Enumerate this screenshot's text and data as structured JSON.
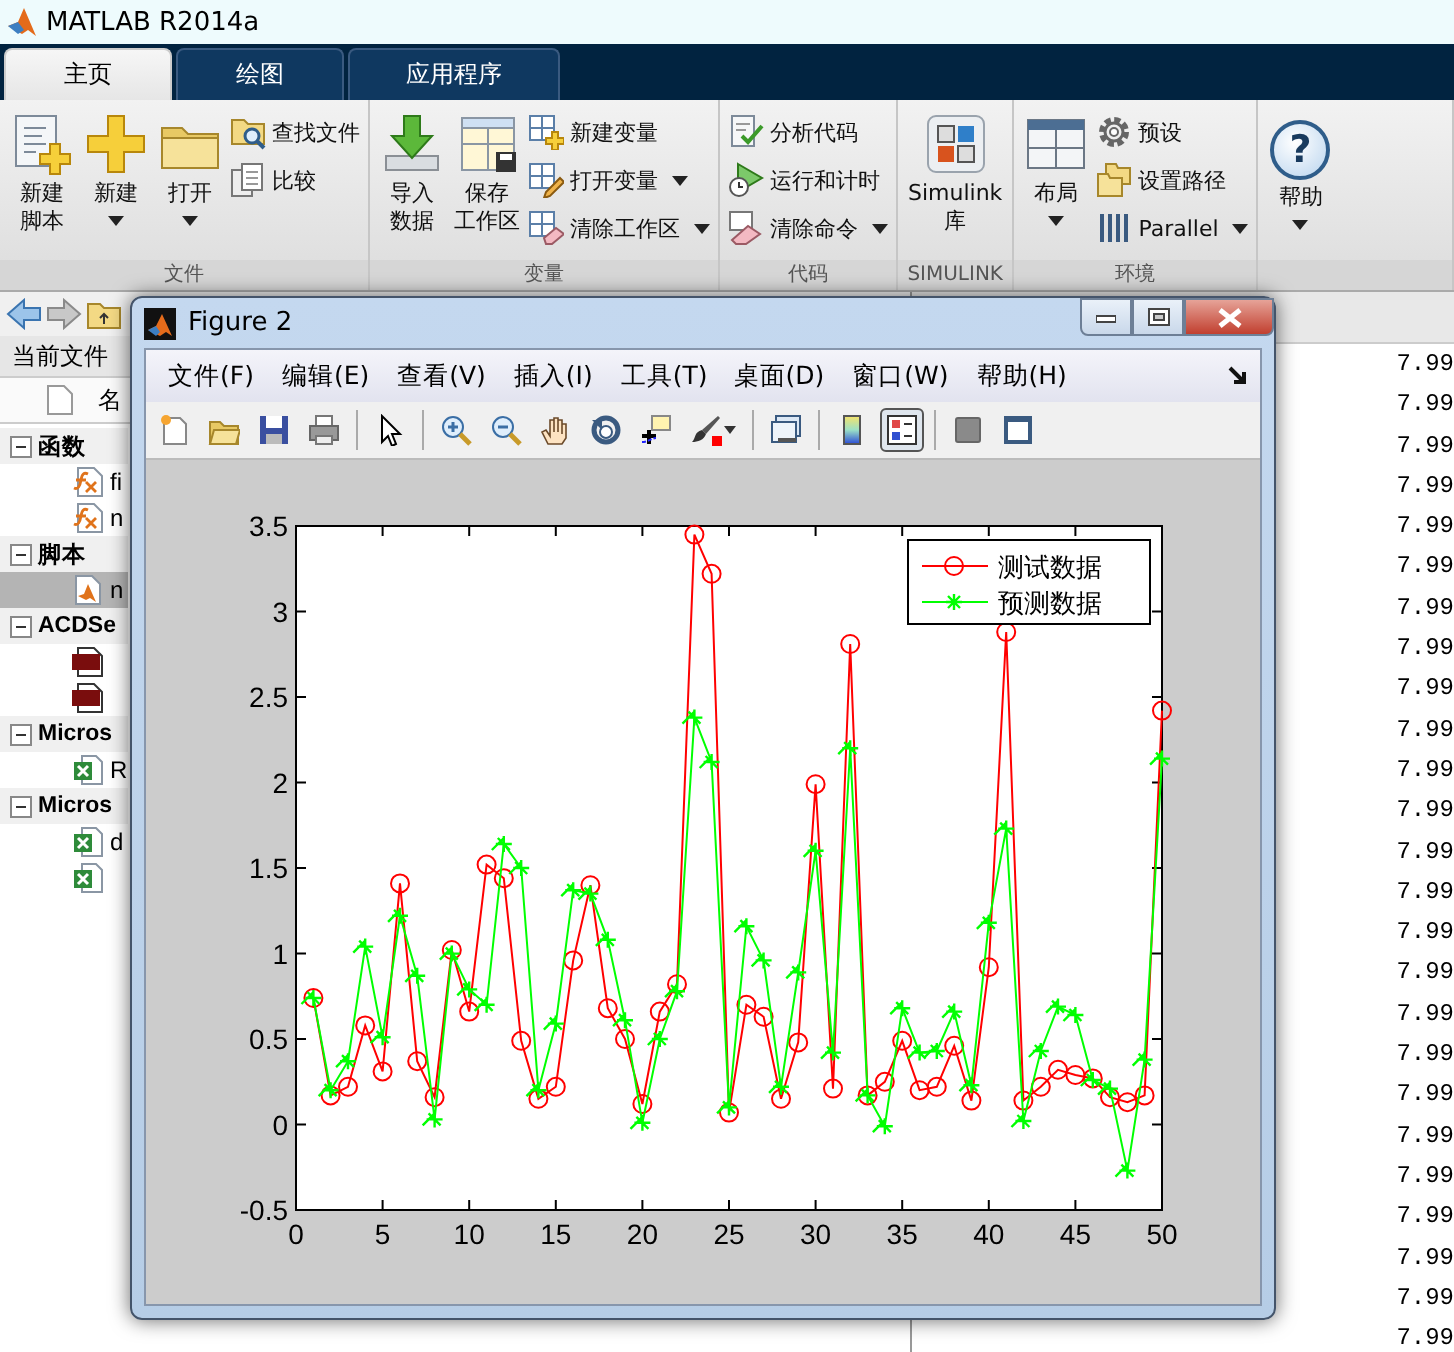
{
  "app": {
    "title": "MATLAB R2014a"
  },
  "tabs": [
    {
      "label": "主页",
      "selected": true
    },
    {
      "label": "绘图",
      "selected": false
    },
    {
      "label": "应用程序",
      "selected": false
    }
  ],
  "ribbon": {
    "sections": [
      {
        "title": "文件",
        "items": [
          {
            "kind": "large",
            "lines": [
              "新建",
              "脚本"
            ],
            "dropdown": false
          },
          {
            "kind": "large",
            "lines": [
              "新建"
            ],
            "dropdown": true
          },
          {
            "kind": "large",
            "lines": [
              "打开"
            ],
            "dropdown": true
          },
          {
            "kind": "small",
            "label": "查找文件",
            "dropdown": false
          },
          {
            "kind": "small",
            "label": "比较",
            "dropdown": false
          }
        ]
      },
      {
        "title": "变量",
        "items": [
          {
            "kind": "large",
            "lines": [
              "导入",
              "数据"
            ],
            "dropdown": false
          },
          {
            "kind": "large",
            "lines": [
              "保存",
              "工作区"
            ],
            "dropdown": false
          },
          {
            "kind": "small",
            "label": "新建变量",
            "dropdown": false
          },
          {
            "kind": "small",
            "label": "打开变量",
            "dropdown": true
          },
          {
            "kind": "small",
            "label": "清除工作区",
            "dropdown": true
          }
        ]
      },
      {
        "title": "代码",
        "items": [
          {
            "kind": "small",
            "label": "分析代码",
            "dropdown": false
          },
          {
            "kind": "small",
            "label": "运行和计时",
            "dropdown": false
          },
          {
            "kind": "small",
            "label": "清除命令",
            "dropdown": true
          }
        ]
      },
      {
        "title": "SIMULINK",
        "items": [
          {
            "kind": "large",
            "lines": [
              "Simulink",
              "库"
            ],
            "dropdown": false
          }
        ]
      },
      {
        "title": "环境",
        "items": [
          {
            "kind": "large",
            "lines": [
              "布局"
            ],
            "dropdown": true
          },
          {
            "kind": "small",
            "label": "预设",
            "dropdown": false
          },
          {
            "kind": "small",
            "label": "设置路径",
            "dropdown": false
          },
          {
            "kind": "small",
            "label": "Parallel",
            "dropdown": true
          }
        ]
      },
      {
        "items": [
          {
            "kind": "help",
            "glyph": "?",
            "lines": [
              "帮助"
            ],
            "dropdown": true
          }
        ]
      }
    ]
  },
  "files": {
    "header": "当前文件",
    "column": "名",
    "groups": [
      {
        "label": "函数",
        "expanded": true,
        "children": [
          {
            "kind": "function",
            "label": "fi",
            "selected": false
          },
          {
            "kind": "function",
            "label": "n",
            "selected": false
          }
        ]
      },
      {
        "label": "脚本",
        "expanded": true,
        "children": [
          {
            "kind": "script",
            "label": "n",
            "selected": true
          }
        ]
      },
      {
        "label": "ACDSe",
        "expanded": true,
        "children": [
          {
            "kind": "image",
            "selected": false
          },
          {
            "kind": "image",
            "selected": false
          }
        ]
      },
      {
        "label": "Micros",
        "expanded": true,
        "children": [
          {
            "kind": "spreadsheet",
            "label": "R",
            "selected": false
          }
        ]
      },
      {
        "label": "Micros",
        "expanded": true,
        "children": [
          {
            "kind": "spreadsheet",
            "label": "d",
            "selected": false
          },
          {
            "kind": "spreadsheet",
            "selected": false
          }
        ]
      }
    ]
  },
  "command_window": {
    "lines": [
      "7.99",
      "7.99",
      "7.99",
      "7.99",
      "7.99",
      "7.99",
      "7.99",
      "7.99",
      "7.99",
      "7.99",
      "7.99",
      "7.99",
      "7.99",
      "7.99",
      "7.99",
      "7.99",
      "7.99",
      "7.99",
      "7.99",
      "7.99",
      "7.99",
      "7.99",
      "7.99",
      "7.99",
      "7.99"
    ]
  },
  "figure": {
    "title": "Figure 2",
    "menu": [
      "文件(F)",
      "编辑(E)",
      "查看(V)",
      "插入(I)",
      "工具(T)",
      "桌面(D)",
      "窗口(W)",
      "帮助(H)"
    ],
    "toolbar": [
      {
        "pressed": false
      },
      {
        "pressed": false
      },
      {
        "pressed": false
      },
      {
        "pressed": false
      },
      {
        "pressed": false
      },
      {
        "pressed": false
      },
      {
        "pressed": false
      },
      {
        "pressed": false
      },
      {
        "pressed": false
      },
      {
        "pressed": false
      },
      {
        "pressed": false
      },
      {
        "pressed": false
      },
      {
        "pressed": false
      },
      {
        "pressed": true
      },
      {
        "pressed": false
      },
      {
        "pressed": false
      }
    ],
    "chart_data": {
      "type": "line",
      "x": [
        1,
        2,
        3,
        4,
        5,
        6,
        7,
        8,
        9,
        10,
        11,
        12,
        13,
        14,
        15,
        16,
        17,
        18,
        19,
        20,
        21,
        22,
        23,
        24,
        25,
        26,
        27,
        28,
        29,
        30,
        31,
        32,
        33,
        34,
        35,
        36,
        37,
        38,
        39,
        40,
        41,
        42,
        43,
        44,
        45,
        46,
        47,
        48,
        49,
        50
      ],
      "legend": "upper right",
      "xlim": [
        0,
        50
      ],
      "ylim": [
        -0.5,
        3.5
      ],
      "xticks": [
        0,
        5,
        10,
        15,
        20,
        25,
        30,
        35,
        40,
        45,
        50
      ],
      "yticks": [
        -0.5,
        0,
        0.5,
        1,
        1.5,
        2,
        2.5,
        3,
        3.5
      ],
      "series": [
        {
          "name": "测试数据",
          "color": "#ff0000",
          "marker": "circle",
          "values": [
            0.74,
            0.17,
            0.22,
            0.58,
            0.31,
            1.41,
            0.37,
            0.16,
            1.02,
            0.66,
            1.52,
            1.44,
            0.49,
            0.15,
            0.22,
            0.96,
            1.4,
            0.68,
            0.5,
            0.12,
            0.66,
            0.82,
            3.45,
            3.22,
            0.07,
            0.7,
            0.63,
            0.15,
            0.48,
            1.99,
            0.21,
            2.81,
            0.17,
            0.25,
            0.49,
            0.2,
            0.22,
            0.46,
            0.14,
            0.92,
            2.88,
            0.14,
            0.22,
            0.32,
            0.29,
            0.27,
            0.16,
            0.13,
            0.17,
            2.42
          ]
        },
        {
          "name": "预测数据",
          "color": "#00ff00",
          "marker": "cross",
          "values": [
            0.74,
            0.2,
            0.37,
            1.04,
            0.51,
            1.22,
            0.87,
            0.03,
            1.0,
            0.79,
            0.7,
            1.64,
            1.5,
            0.2,
            0.59,
            1.37,
            1.35,
            1.08,
            0.61,
            0.01,
            0.5,
            0.78,
            2.38,
            2.12,
            0.1,
            1.16,
            0.96,
            0.22,
            0.89,
            1.6,
            0.42,
            2.2,
            0.17,
            -0.01,
            0.68,
            0.42,
            0.43,
            0.66,
            0.23,
            1.18,
            1.73,
            0.02,
            0.43,
            0.69,
            0.64,
            0.26,
            0.21,
            -0.27,
            0.38,
            2.14
          ]
        }
      ]
    }
  }
}
